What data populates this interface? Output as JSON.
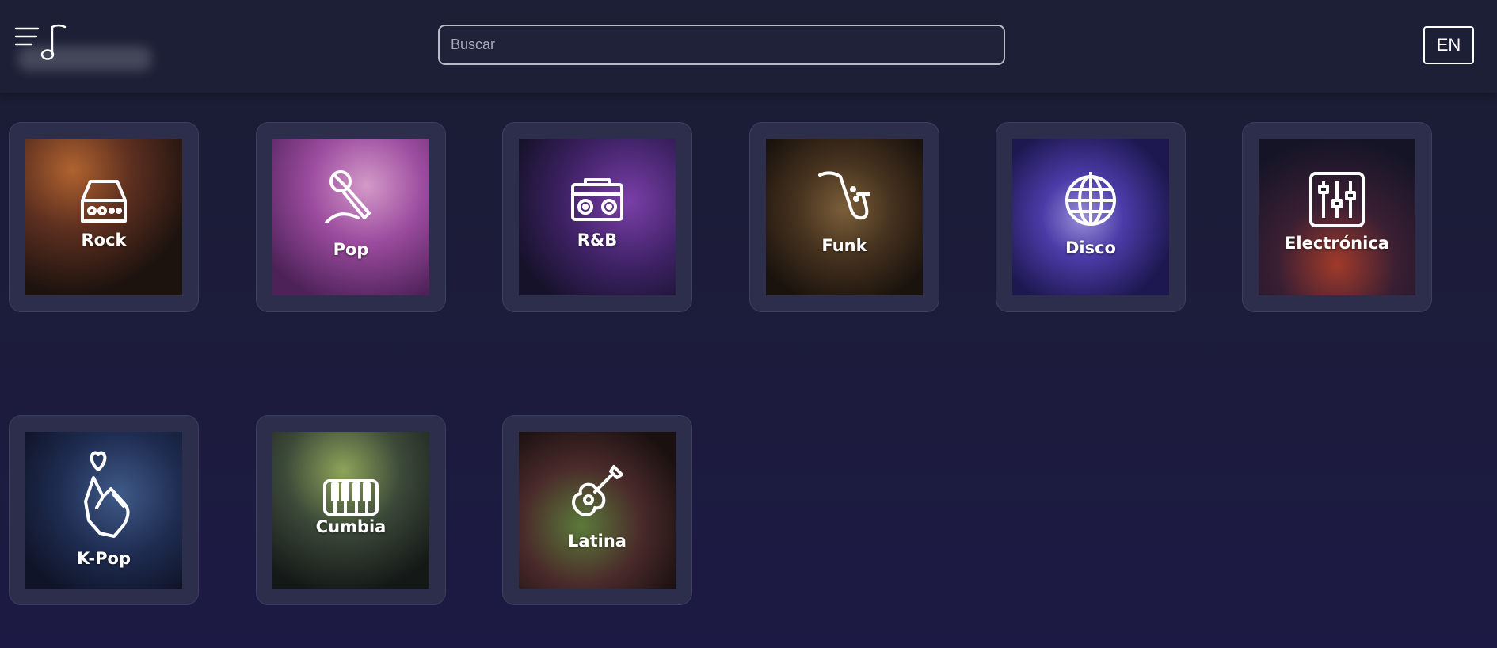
{
  "header": {
    "search_placeholder": "Buscar",
    "language_label": "EN"
  },
  "genres": [
    {
      "label": "Rock",
      "icon": "amplifier-icon"
    },
    {
      "label": "Pop",
      "icon": "microphone-icon"
    },
    {
      "label": "R&B",
      "icon": "boombox-icon"
    },
    {
      "label": "Funk",
      "icon": "saxophone-icon"
    },
    {
      "label": "Disco",
      "icon": "disco-ball-icon"
    },
    {
      "label": "Electrónica",
      "icon": "mixer-sliders-icon"
    },
    {
      "label": "K-Pop",
      "icon": "finger-heart-icon"
    },
    {
      "label": "Cumbia",
      "icon": "keyboard-icon"
    },
    {
      "label": "Latina",
      "icon": "guitar-icon"
    }
  ],
  "colors": {
    "background": "#1b1d33",
    "header": "#1c1f36",
    "card": "#2c2e4b"
  }
}
